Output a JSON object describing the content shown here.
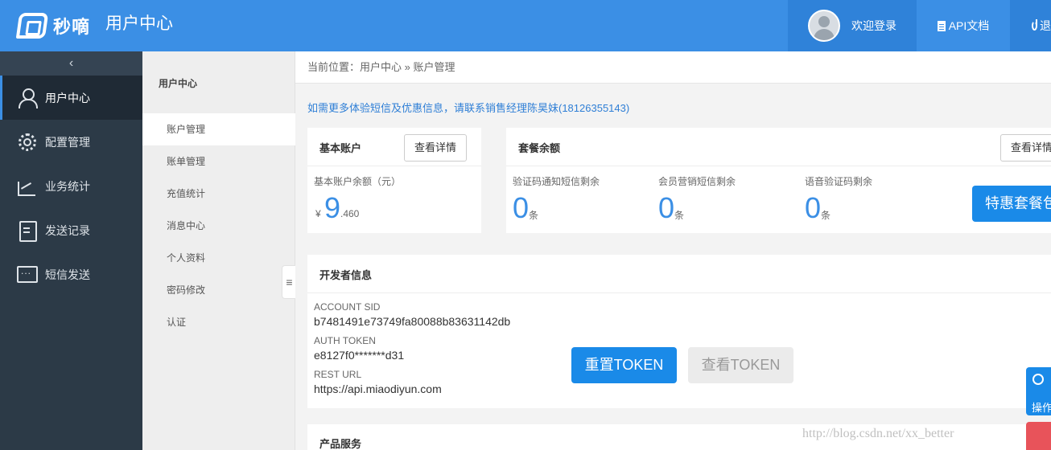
{
  "header": {
    "logo_text": "秒嘀",
    "app_title": "用户中心",
    "welcome": "欢迎登录",
    "api_doc": "API文档",
    "logout": "退"
  },
  "sidebar": {
    "collapse_icon": "chevron-left-icon",
    "items": [
      {
        "label": "用户中心",
        "icon": "user-icon"
      },
      {
        "label": "配置管理",
        "icon": "gear-icon"
      },
      {
        "label": "业务统计",
        "icon": "chart-icon"
      },
      {
        "label": "发送记录",
        "icon": "document-icon"
      },
      {
        "label": "短信发送",
        "icon": "chat-icon"
      }
    ]
  },
  "subnav": {
    "title": "用户中心",
    "items": [
      "账户管理",
      "账单管理",
      "充值统计",
      "消息中心",
      "个人资料",
      "密码修改",
      "认证"
    ],
    "toggle": "≡"
  },
  "breadcrumb": "当前位置：用户中心 » 账户管理",
  "notice": "如需更多体验短信及优惠信息，请联系销售经理陈昊妹(18126355143)",
  "basic_account": {
    "title": "基本账户",
    "detail_button": "查看详情",
    "balance_label": "基本账户余额（元）",
    "currency": "¥",
    "integer": "9",
    "decimal": ".460"
  },
  "package": {
    "title": "套餐余额",
    "detail_button": "查看详情",
    "items": [
      {
        "label": "验证码通知短信剩余",
        "value": "0",
        "unit": "条"
      },
      {
        "label": "会员营销短信剩余",
        "value": "0",
        "unit": "条"
      },
      {
        "label": "语音验证码剩余",
        "value": "0",
        "unit": "条"
      }
    ],
    "promo_button": "特惠套餐包"
  },
  "developer": {
    "title": "开发者信息",
    "sid_label": "ACCOUNT SID",
    "sid_value": "b7481491e73749fa80088b83631142db",
    "token_label": "AUTH TOKEN",
    "token_value": "e8127f0*******d31",
    "url_label": "REST URL",
    "url_value": "https://api.miaodiyun.com",
    "reset_button": "重置TOKEN",
    "view_button": "查看TOKEN"
  },
  "product_service": {
    "title": "产品服务"
  },
  "float_button": {
    "label": "操作"
  },
  "watermark": "http://blog.csdn.net/xx_better",
  "colors": {
    "primary": "#3b8fe5",
    "sidebar": "#2c3a47",
    "button": "#1a8ae8"
  }
}
